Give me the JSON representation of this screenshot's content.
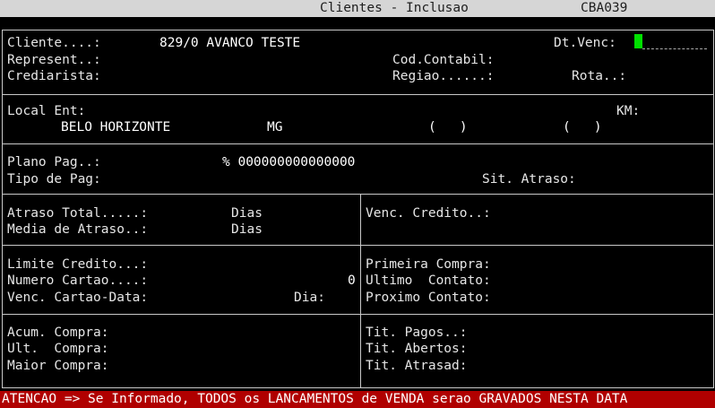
{
  "title_bar": {
    "title": "Clientes - Inclusao",
    "code": "CBA039"
  },
  "header": {
    "cliente_label": "Cliente....:",
    "cliente_value": "829/0 AVANCO TESTE",
    "dtvenc_label": "Dt.Venc:",
    "represent_label": "Represent..:",
    "codcontabil_label": "Cod.Contabil:",
    "crediarista_label": "Crediarista:",
    "regiao_label": "Regiao......:",
    "rota_label": "Rota..:"
  },
  "local": {
    "local_label": "Local Ent:",
    "km_label": "KM:",
    "city": "BELO HORIZONTE",
    "state": "MG",
    "paren1": "(   )",
    "paren2": "(   )"
  },
  "plano": {
    "plano_label": "Plano Pag..:",
    "percent_value": "% 000000000000000",
    "tipo_label": "Tipo de Pag:",
    "sit_label": "Sit. Atraso:"
  },
  "atraso": {
    "total_label": "Atraso Total.....:",
    "total_unit": "Dias",
    "media_label": "Media de Atraso..:",
    "media_unit": "Dias",
    "venc_credito_label": "Venc. Credito..:"
  },
  "credito": {
    "limite_label": "Limite Credito...:",
    "numero_label": "Numero Cartao....:",
    "numero_value": "0",
    "venc_cartao_label": "Venc. Cartao-Data:",
    "dia_label": "Dia:",
    "primeira_label": "Primeira Compra:",
    "ultimo_label": "Ultimo  Contato:",
    "proximo_label": "Proximo Contato:"
  },
  "compras": {
    "acum_label": "Acum. Compra:",
    "ult_label": "Ult.  Compra:",
    "maior_label": "Maior Compra:",
    "pagos_label": "Tit. Pagos..:",
    "abertos_label": "Tit. Abertos:",
    "atrasad_label": "Tit. Atrasad:"
  },
  "status_bar": {
    "message": "ATENCAO => Se Informado, TODOS os LANCAMENTOS de VENDA serao GRAVADOS NESTA DATA"
  }
}
